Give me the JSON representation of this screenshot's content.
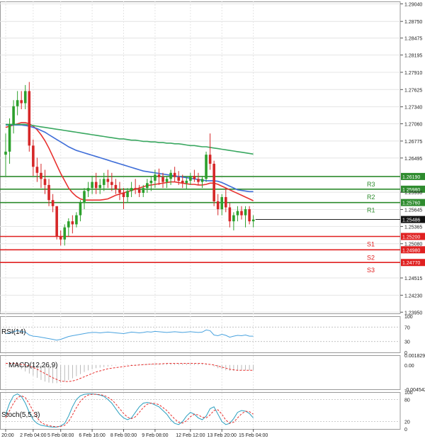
{
  "colors": {
    "up": "#2ca02c",
    "down": "#d62728",
    "ma_red": "#e8312f",
    "ma_blue": "#3f6ed8",
    "ma_green": "#3aa861",
    "resistance": "#2e8b2e",
    "support": "#e02020",
    "rsi": "#4aa3df",
    "grid": "#e4e4e4",
    "frame": "#9a9a9a"
  },
  "chart_data": [
    {
      "type": "candlestick",
      "y_axis_ticks": [
        "1.29040",
        "1.28750",
        "1.28475",
        "1.28195",
        "1.27910",
        "1.27625",
        "1.27340",
        "1.27060",
        "1.26775",
        "1.26495",
        "1.25930",
        "1.25645",
        "1.25365",
        "1.25080",
        "1.24515",
        "1.24230",
        "1.23950"
      ],
      "ylim": [
        1.2393,
        1.2908
      ],
      "x_labels": [
        "n 20:00",
        "2 Feb 04:00",
        "5 Feb 08:00",
        "6 Feb 16:00",
        "8 Feb 00:00",
        "9 Feb 08:00",
        "12 Feb 12:00",
        "13 Feb 20:00",
        "15 Feb 04:00"
      ],
      "current_price": "1.25486",
      "ohlc": [
        [
          1.2655,
          1.269,
          1.262,
          1.266
        ],
        [
          1.266,
          1.2715,
          1.264,
          1.2705
        ],
        [
          1.2705,
          1.2745,
          1.269,
          1.2735
        ],
        [
          1.2735,
          1.276,
          1.272,
          1.2745
        ],
        [
          1.2745,
          1.276,
          1.273,
          1.274
        ],
        [
          1.274,
          1.277,
          1.273,
          1.276
        ],
        [
          1.276,
          1.2775,
          1.266,
          1.267
        ],
        [
          1.267,
          1.268,
          1.262,
          1.2635
        ],
        [
          1.2635,
          1.265,
          1.261,
          1.2625
        ],
        [
          1.2625,
          1.264,
          1.26,
          1.2615
        ],
        [
          1.2615,
          1.263,
          1.259,
          1.2605
        ],
        [
          1.2605,
          1.2615,
          1.257,
          1.258
        ],
        [
          1.258,
          1.259,
          1.256,
          1.257
        ],
        [
          1.257,
          1.257,
          1.2515,
          1.252
        ],
        [
          1.252,
          1.253,
          1.2505,
          1.2515
        ],
        [
          1.2515,
          1.254,
          1.2505,
          1.2535
        ],
        [
          1.2535,
          1.255,
          1.252,
          1.2545
        ],
        [
          1.2545,
          1.2555,
          1.2525,
          1.254
        ],
        [
          1.254,
          1.256,
          1.2535,
          1.2555
        ],
        [
          1.2555,
          1.258,
          1.2545,
          1.2575
        ],
        [
          1.2575,
          1.26,
          1.2565,
          1.2595
        ],
        [
          1.2595,
          1.261,
          1.2585,
          1.26
        ],
        [
          1.26,
          1.262,
          1.259,
          1.261
        ],
        [
          1.261,
          1.2625,
          1.259,
          1.26
        ],
        [
          1.26,
          1.2615,
          1.259,
          1.2605
        ],
        [
          1.2605,
          1.2625,
          1.2595,
          1.2615
        ],
        [
          1.2615,
          1.263,
          1.26,
          1.261
        ],
        [
          1.261,
          1.2625,
          1.2595,
          1.2605
        ],
        [
          1.2605,
          1.2615,
          1.259,
          1.2598
        ],
        [
          1.2598,
          1.261,
          1.258,
          1.2592
        ],
        [
          1.2592,
          1.26,
          1.2565,
          1.2585
        ],
        [
          1.2585,
          1.26,
          1.2575,
          1.2595
        ],
        [
          1.2595,
          1.261,
          1.2585,
          1.26
        ],
        [
          1.26,
          1.2615,
          1.259,
          1.2598
        ],
        [
          1.2598,
          1.2605,
          1.2585,
          1.2592
        ],
        [
          1.2592,
          1.2605,
          1.2585,
          1.26
        ],
        [
          1.26,
          1.2615,
          1.2592,
          1.2608
        ],
        [
          1.2608,
          1.262,
          1.2595,
          1.2612
        ],
        [
          1.2612,
          1.263,
          1.26,
          1.2622
        ],
        [
          1.2622,
          1.2632,
          1.2605,
          1.2618
        ],
        [
          1.2618,
          1.2625,
          1.26,
          1.261
        ],
        [
          1.261,
          1.262,
          1.26,
          1.2615
        ],
        [
          1.2615,
          1.263,
          1.2605,
          1.2625
        ],
        [
          1.2625,
          1.2635,
          1.261,
          1.2618
        ],
        [
          1.2618,
          1.2628,
          1.2605,
          1.2612
        ],
        [
          1.2612,
          1.2622,
          1.26,
          1.2608
        ],
        [
          1.2608,
          1.2618,
          1.2598,
          1.2612
        ],
        [
          1.2612,
          1.2625,
          1.2605,
          1.262
        ],
        [
          1.262,
          1.263,
          1.261,
          1.2615
        ],
        [
          1.2615,
          1.2625,
          1.2605,
          1.261
        ],
        [
          1.261,
          1.262,
          1.26,
          1.2615
        ],
        [
          1.2615,
          1.266,
          1.261,
          1.2655
        ],
        [
          1.2655,
          1.269,
          1.263,
          1.264
        ],
        [
          1.264,
          1.2645,
          1.257,
          1.2578
        ],
        [
          1.2578,
          1.259,
          1.2555,
          1.2565
        ],
        [
          1.2565,
          1.259,
          1.2555,
          1.2585
        ],
        [
          1.2585,
          1.26,
          1.256,
          1.2568
        ],
        [
          1.2568,
          1.2575,
          1.2535,
          1.2545
        ],
        [
          1.2545,
          1.256,
          1.253,
          1.2555
        ],
        [
          1.2555,
          1.257,
          1.2545,
          1.2562
        ],
        [
          1.2562,
          1.257,
          1.2548,
          1.2555
        ],
        [
          1.2555,
          1.257,
          1.2535,
          1.2565
        ],
        [
          1.2565,
          1.257,
          1.254,
          1.2545
        ],
        [
          1.2545,
          1.2555,
          1.2535,
          1.2548
        ]
      ],
      "moving_averages": [
        {
          "color": "red",
          "values": [
            1.27,
            1.2702,
            1.2704,
            1.2706,
            1.2708,
            1.2708,
            1.2706,
            1.2702,
            1.2696,
            1.2688,
            1.2678,
            1.2666,
            1.2652,
            1.2638,
            1.2624,
            1.2612,
            1.26,
            1.2592,
            1.2586,
            1.2582,
            1.258,
            1.258,
            1.258,
            1.258,
            1.258,
            1.2581,
            1.2582,
            1.2585,
            1.2588,
            1.259,
            1.2592,
            1.2594,
            1.2596,
            1.2598,
            1.26,
            1.2602,
            1.2604,
            1.2605,
            1.2606,
            1.2607,
            1.2608,
            1.2609,
            1.261,
            1.261,
            1.2609,
            1.2608,
            1.2607,
            1.2606,
            1.2606,
            1.2605,
            1.2605,
            1.2606,
            1.2608,
            1.2608,
            1.2606,
            1.2603,
            1.26,
            1.2597,
            1.2594,
            1.2591,
            1.2588,
            1.2585,
            1.2582,
            1.2579
          ]
        },
        {
          "color": "blue",
          "values": [
            1.2704,
            1.2704,
            1.2704,
            1.2704,
            1.2704,
            1.2703,
            1.2702,
            1.27,
            1.2698,
            1.2695,
            1.2692,
            1.2688,
            1.2684,
            1.268,
            1.2676,
            1.2672,
            1.2668,
            1.2665,
            1.2662,
            1.266,
            1.2658,
            1.2656,
            1.2654,
            1.2652,
            1.265,
            1.2648,
            1.2646,
            1.2644,
            1.2642,
            1.264,
            1.2638,
            1.2636,
            1.2634,
            1.2632,
            1.263,
            1.2628,
            1.2627,
            1.2626,
            1.2625,
            1.2624,
            1.2623,
            1.2622,
            1.2621,
            1.262,
            1.2619,
            1.2618,
            1.2617,
            1.2616,
            1.2615,
            1.2614,
            1.2613,
            1.2612,
            1.2612,
            1.2612,
            1.2611,
            1.2609,
            1.2606,
            1.2603,
            1.26,
            1.2597,
            1.2596,
            1.2595,
            1.2594,
            1.2594
          ]
        },
        {
          "color": "green",
          "values": [
            1.2705,
            1.2705,
            1.2705,
            1.2705,
            1.2705,
            1.2705,
            1.2704,
            1.2703,
            1.2702,
            1.2701,
            1.27,
            1.2699,
            1.2698,
            1.2697,
            1.2696,
            1.2695,
            1.2694,
            1.2693,
            1.2692,
            1.2691,
            1.269,
            1.2689,
            1.2688,
            1.2687,
            1.2686,
            1.2685,
            1.2684,
            1.2683,
            1.2682,
            1.2681,
            1.2681,
            1.268,
            1.2679,
            1.2679,
            1.2678,
            1.2677,
            1.2677,
            1.2676,
            1.2676,
            1.2675,
            1.2675,
            1.2674,
            1.2674,
            1.2673,
            1.2673,
            1.2672,
            1.2671,
            1.267,
            1.267,
            1.2669,
            1.2668,
            1.2668,
            1.2667,
            1.2666,
            1.2665,
            1.2664,
            1.2663,
            1.2662,
            1.2661,
            1.266,
            1.2659,
            1.2658,
            1.2657,
            1.2656
          ]
        }
      ],
      "levels": [
        {
          "label": "R3",
          "value": 1.2619,
          "price": "1.26190",
          "kind": "resistance"
        },
        {
          "label": "R2",
          "value": 1.2598,
          "price": "1.25980",
          "kind": "resistance"
        },
        {
          "label": "R1",
          "value": 1.2576,
          "price": "1.25760",
          "kind": "resistance"
        },
        {
          "label": "S1",
          "value": 1.252,
          "price": "1.25200",
          "kind": "support"
        },
        {
          "label": "S2",
          "value": 1.2498,
          "price": "1.24980",
          "kind": "support"
        },
        {
          "label": "S3",
          "value": 1.2477,
          "price": "1.24770",
          "kind": "support"
        }
      ]
    },
    {
      "type": "line",
      "title": "RSI(14)",
      "ylim": [
        0,
        100
      ],
      "y_ticks": [
        "100",
        "70",
        "30",
        "0"
      ],
      "values": [
        52,
        54,
        57,
        60,
        58,
        56,
        48,
        45,
        44,
        42,
        40,
        38,
        36,
        34,
        36,
        40,
        44,
        46,
        48,
        50,
        52,
        54,
        55,
        55,
        54,
        55,
        56,
        55,
        54,
        53,
        52,
        54,
        56,
        55,
        54,
        55,
        57,
        56,
        58,
        57,
        56,
        55,
        56,
        57,
        56,
        55,
        56,
        57,
        56,
        55,
        56,
        62,
        60,
        48,
        46,
        50,
        47,
        42,
        45,
        47,
        46,
        48,
        45,
        45
      ]
    },
    {
      "type": "line",
      "title": "MACD(12,26,9)",
      "y_ticks": [
        "0.001829",
        "0.00",
        "-0.004542"
      ],
      "ylim": [
        -0.004542,
        0.001829
      ],
      "signal": [
        0.0003,
        0.0003,
        0.0003,
        0.0002,
        0.0001,
        0.0,
        -0.0002,
        -0.0005,
        -0.0008,
        -0.0012,
        -0.0016,
        -0.002,
        -0.0024,
        -0.0027,
        -0.003,
        -0.0031,
        -0.0031,
        -0.003,
        -0.0028,
        -0.0025,
        -0.0022,
        -0.0019,
        -0.0016,
        -0.0013,
        -0.0011,
        -0.0009,
        -0.0007,
        -0.0006,
        -0.0005,
        -0.0004,
        -0.0003,
        -0.0002,
        -0.0001,
        -5e-05,
        0.0,
        5e-05,
        0.0001,
        0.00015,
        0.0002,
        0.0002,
        0.00025,
        0.0003,
        0.0003,
        0.0003,
        0.0003,
        0.0003,
        0.0003,
        0.0003,
        0.0003,
        0.0003,
        0.0003,
        0.0002,
        0.0001,
        0.0,
        -0.0002,
        -0.0004,
        -0.0006,
        -0.0008,
        -0.0009,
        -0.001,
        -0.001,
        -0.001,
        -0.001,
        -0.001
      ],
      "histogram": [
        0.0001,
        0.0,
        -0.0002,
        -0.0005,
        -0.0008,
        -0.0012,
        -0.0016,
        -0.002,
        -0.0024,
        -0.0028,
        -0.0031,
        -0.0033,
        -0.0034,
        -0.0034,
        -0.0033,
        -0.0031,
        -0.0028,
        -0.0025,
        -0.0021,
        -0.0017,
        -0.0013,
        -0.001,
        -0.0008,
        -0.0006,
        -0.0005,
        -0.0004,
        -0.0003,
        -0.0002,
        -0.0001,
        0.0,
        0.0,
        0.0001,
        0.0001,
        0.0001,
        0.0002,
        0.0002,
        0.0002,
        0.0002,
        0.0003,
        0.0003,
        0.0003,
        0.0003,
        0.0003,
        0.0003,
        0.0003,
        0.0003,
        0.0003,
        0.0003,
        0.0003,
        0.0003,
        0.0002,
        0.0002,
        0.0,
        -0.0003,
        -0.0006,
        -0.0008,
        -0.001,
        -0.0011,
        -0.0011,
        -0.0011,
        -0.001,
        -0.001,
        -0.001,
        -0.001
      ]
    },
    {
      "type": "line",
      "title": "Stoch(5,5,3)",
      "ylim": [
        0,
        100
      ],
      "y_ticks": [
        "100",
        "80",
        "20",
        "0"
      ],
      "k": [
        40,
        70,
        90,
        95,
        88,
        70,
        45,
        25,
        15,
        10,
        8,
        6,
        5,
        5,
        8,
        15,
        35,
        60,
        80,
        90,
        94,
        95,
        95,
        94,
        92,
        88,
        80,
        70,
        55,
        40,
        30,
        25,
        30,
        45,
        60,
        70,
        72,
        70,
        65,
        60,
        50,
        40,
        25,
        15,
        12,
        20,
        35,
        45,
        40,
        30,
        25,
        35,
        55,
        60,
        40,
        20,
        12,
        15,
        28,
        45,
        50,
        48,
        42,
        30
      ],
      "d": [
        30,
        50,
        70,
        85,
        90,
        85,
        68,
        48,
        30,
        18,
        12,
        9,
        7,
        6,
        7,
        10,
        20,
        38,
        58,
        75,
        86,
        92,
        94,
        94,
        93,
        91,
        86,
        79,
        68,
        55,
        42,
        32,
        28,
        33,
        45,
        58,
        67,
        70,
        69,
        66,
        58,
        50,
        38,
        27,
        18,
        16,
        22,
        33,
        40,
        38,
        32,
        30,
        38,
        50,
        52,
        40,
        24,
        16,
        18,
        30,
        41,
        48,
        47,
        40
      ]
    }
  ]
}
